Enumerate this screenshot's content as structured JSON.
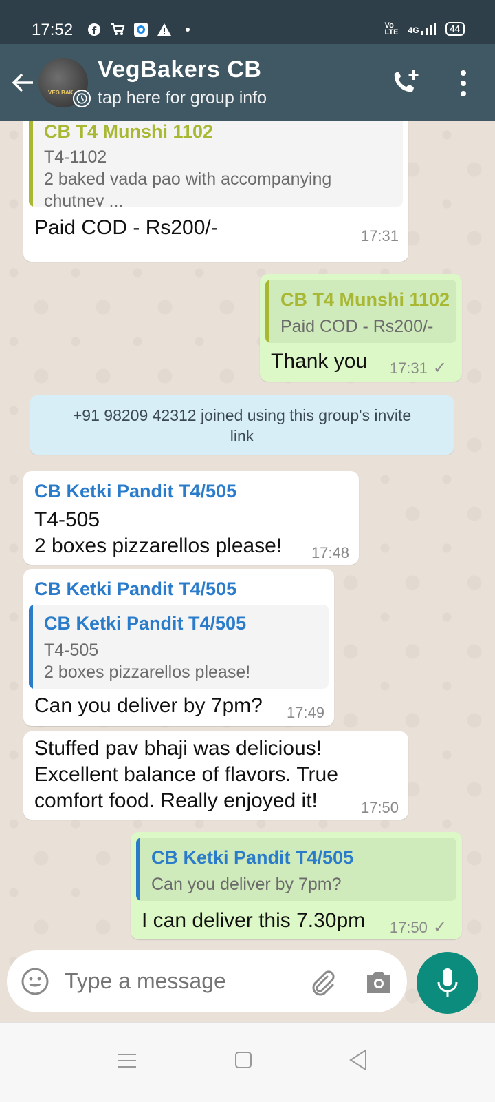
{
  "status_bar": {
    "time": "17:52",
    "network": "4G",
    "battery": "44"
  },
  "header": {
    "title": "VegBakers CB",
    "subtitle": "tap here for group info",
    "avatar_text": "VEG BAK"
  },
  "colors": {
    "header": "#3f5863",
    "incoming_bubble": "#ffffff",
    "outgoing_bubble": "#dcf8c6",
    "accent_green": "#a9b832",
    "accent_blue": "#2a7ccb",
    "fab": "#0c8c7c"
  },
  "messages": [
    {
      "quote_name": "CB T4 Munshi 1102",
      "quote_line1": "T4-1102",
      "quote_line2": "2 baked vada pao with accompanying",
      "quote_line3": "chutney ...",
      "text": "Paid COD - Rs200/-",
      "time": "17:31"
    },
    {
      "quote_name": "CB T4 Munshi 1102",
      "quote_line1": "Paid COD - Rs200/-",
      "text": "Thank you",
      "time": "17:31"
    },
    {
      "system_line1": "+91 98209 42312 joined using this group's invite",
      "system_line2": "link"
    },
    {
      "sender": "CB Ketki Pandit T4/505",
      "line1": "T4-505",
      "line2": "2 boxes pizzarellos please!",
      "time": "17:48"
    },
    {
      "sender": "CB Ketki Pandit T4/505",
      "quote_name": "CB Ketki Pandit T4/505",
      "quote_line1": "T4-505",
      "quote_line2": "2 boxes pizzarellos please!",
      "text": "Can you deliver by 7pm?",
      "time": "17:49"
    },
    {
      "line1": "Stuffed pav bhaji was delicious!",
      "line2": "Excellent balance of flavors. True",
      "line3": "comfort food. Really enjoyed it!",
      "time": "17:50"
    },
    {
      "quote_name": "CB Ketki Pandit T4/505",
      "quote_line1": "Can you deliver by 7pm?",
      "text": "I can deliver this 7.30pm",
      "time": "17:50"
    }
  ],
  "input": {
    "placeholder": "Type a message"
  }
}
